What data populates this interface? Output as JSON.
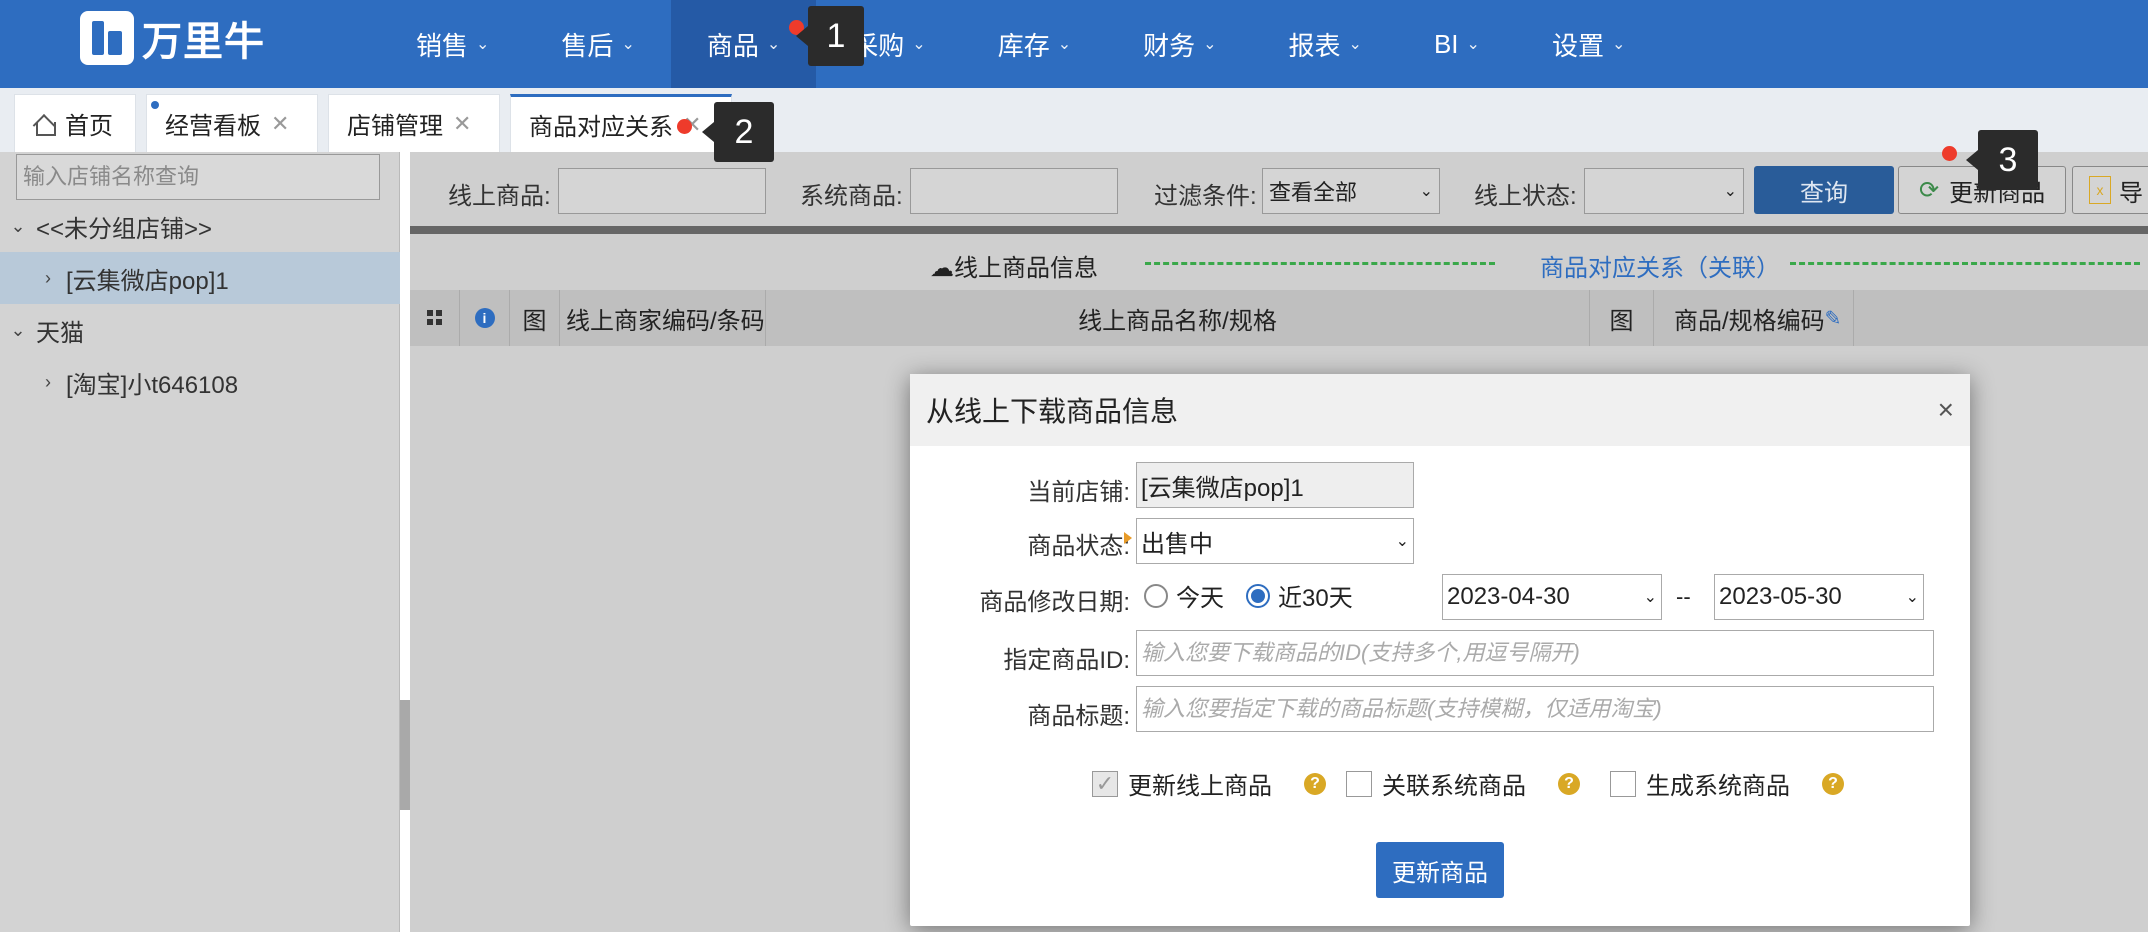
{
  "brand": {
    "name": "万里牛"
  },
  "nav": [
    {
      "label": "销售"
    },
    {
      "label": "售后"
    },
    {
      "label": "商品"
    },
    {
      "label": "采购"
    },
    {
      "label": "库存"
    },
    {
      "label": "财务"
    },
    {
      "label": "报表"
    },
    {
      "label": "BI"
    },
    {
      "label": "设置"
    }
  ],
  "callouts": [
    "1",
    "2",
    "3"
  ],
  "tabs": [
    {
      "label": "首页"
    },
    {
      "label": "经营看板"
    },
    {
      "label": "店铺管理"
    },
    {
      "label": "商品对应关系"
    }
  ],
  "sidebar": {
    "search_placeholder": "输入店铺名称查询",
    "tree": [
      {
        "label": "<<未分组店铺>>"
      },
      {
        "label": "[云集微店pop]1"
      },
      {
        "label": "天猫"
      },
      {
        "label": "[淘宝]小t646108"
      }
    ]
  },
  "filter": {
    "online_label": "线上商品:",
    "system_label": "系统商品:",
    "filter_label": "过滤条件:",
    "filter_value": "查看全部",
    "status_label": "线上状态:",
    "query_button": "查询",
    "refresh_button": "更新商品",
    "import_button": "导"
  },
  "sections": {
    "left": "线上商品信息",
    "right": "商品对应关系（关联）"
  },
  "table": {
    "columns": [
      "图",
      "线上商家编码/条码",
      "线上商品名称/规格",
      "图",
      "商品/规格编码"
    ]
  },
  "modal": {
    "title": "从线上下载商品信息",
    "shop_label": "当前店铺:",
    "shop_value": "[云集微店pop]1",
    "status_label": "商品状态:",
    "status_value": "出售中",
    "date_label": "商品修改日期:",
    "radio_today": "今天",
    "radio_30": "近30天",
    "date_from": "2023-04-30",
    "date_sep": "--",
    "date_to": "2023-05-30",
    "id_label": "指定商品ID:",
    "id_placeholder": "输入您要下载商品的ID(支持多个,用逗号隔开)",
    "title_label": "商品标题:",
    "title_placeholder": "输入您要指定下载的商品标题(支持模糊，仅适用淘宝)",
    "chk_update": "更新线上商品",
    "chk_link": "关联系统商品",
    "chk_generate": "生成系统商品",
    "submit": "更新商品"
  },
  "colors": {
    "primary": "#2e6dc0",
    "nav_active": "#255aa6",
    "badge": "#ee3b2b",
    "help": "#d9a825"
  }
}
